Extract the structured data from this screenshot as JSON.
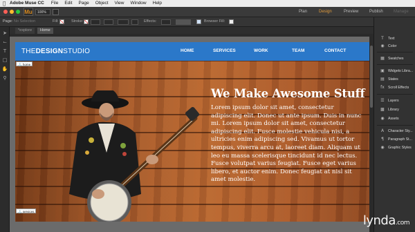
{
  "menubar": {
    "apple": "",
    "app_name": "Adobe Muse CC",
    "items": [
      "File",
      "Edit",
      "Page",
      "Object",
      "View",
      "Window",
      "Help"
    ]
  },
  "app_toolbar": {
    "logo": "Mu",
    "zoom": "100%",
    "modes": [
      "Plan",
      "Design",
      "Preview",
      "Publish",
      "Manage"
    ],
    "active_mode": "Design"
  },
  "control_bar": {
    "page_label": "Page:",
    "page_value": "No Selection",
    "fill_label": "Fill:",
    "stroke_label": "Stroke:",
    "stroke_value": "0",
    "effects_label": "Effects:",
    "browser_fill_label": "Browser Fill:"
  },
  "doc_tabs": [
    {
      "label": "*explore",
      "active": false
    },
    {
      "label": "Home",
      "active": true
    }
  ],
  "site": {
    "logo_light": "THE",
    "logo_bold": "DESIGN",
    "logo_rest": "STUDIO",
    "nav": [
      "HOME",
      "SERVICES",
      "WORK",
      "TEAM",
      "CONTACT"
    ],
    "headline": "We Make Awesome Stuff",
    "body": "Lorem ipsum dolor sit amet, consectetur adipiscing elit. Donec ut ante ipsum. Duis in nunc mi. Lorem ipsum dolor sit amet, consectetur adipiscing elit. Fusce molestie vehicula nisi, a ultricies enim adipiscing sed. Vivamus ut tortor tempus, viverra arcu at, laoreet diam. Aliquam ut leo eu massa scelerisque tincidunt id nec lectus. Fusce volutpat varius feugiat. Fusce eget varius libero, et auctor enim. Donec feugiat at nisl sit amet molestie.",
    "anchor_home": "home",
    "anchor_services": "services"
  },
  "panel": {
    "items": [
      "Text",
      "Color",
      "Swatches",
      "Widgets Libra...",
      "States",
      "Scroll Effects",
      "Layers",
      "Library",
      "Assets",
      "Character Sty...",
      "Paragraph St...",
      "Graphic Styles"
    ]
  },
  "watermark": {
    "brand": "lynda",
    "suffix": ".com"
  },
  "colors": {
    "accent": "#2b78c9",
    "mode_active": "#e29b3c"
  }
}
